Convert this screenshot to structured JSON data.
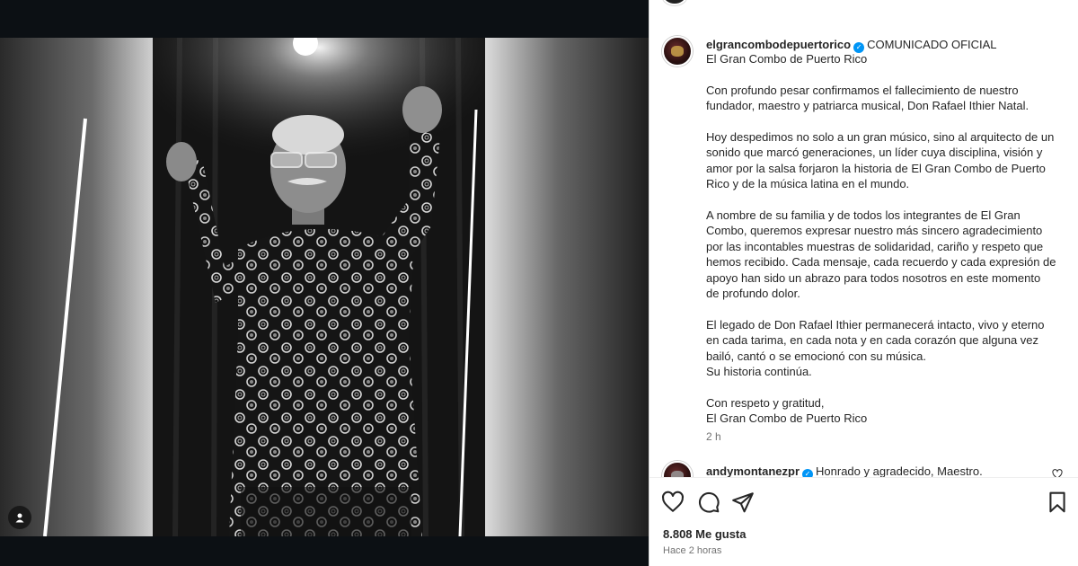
{
  "post": {
    "author": "elgrancombodepuertorico",
    "title": "COMUNICADO OFICIAL",
    "caption_lines": [
      "El Gran Combo de Puerto Rico",
      "",
      "Con profundo pesar confirmamos el fallecimiento de nuestro",
      "fundador, maestro y patriarca musical, Don Rafael Ithier Natal.",
      "",
      "Hoy despedimos no solo a un gran músico, sino al arquitecto de un",
      "sonido que marcó generaciones, un líder cuya disciplina, visión y",
      "amor por la salsa forjaron la historia de El Gran Combo de Puerto",
      "Rico y de la música latina en el mundo.",
      "",
      "A nombre de su familia y de todos los integrantes de El Gran",
      "Combo, queremos expresar nuestro más sincero agradecimiento",
      "por las incontables muestras de solidaridad, cariño y respeto que",
      "hemos recibido. Cada mensaje, cada recuerdo y cada expresión de",
      "apoyo han sido un abrazo para todos nosotros en este momento",
      "de profundo dolor.",
      "",
      "El legado de Don Rafael Ithier permanecerá intacto, vivo y eterno",
      "en cada tarima, en cada nota y en cada corazón que alguna vez",
      "bailó, cantó o se emocionó con su música.",
      "Su historia continúa.",
      "",
      "Con respeto y gratitud,",
      "El Gran Combo de Puerto Rico"
    ],
    "time": "2 h"
  },
  "comment": {
    "author": "andymontanezpr",
    "text": "Honrado y agradecido, Maestro."
  },
  "stats": {
    "likes": "8.808 Me gusta",
    "posted": "Hace 2 horas"
  },
  "icons": {
    "like": "heart-icon",
    "comment": "comment-icon",
    "share": "share-icon",
    "save": "bookmark-icon",
    "verified": "verified-badge-icon",
    "tag": "user-tag-icon"
  },
  "colors": {
    "verified": "#0095f6",
    "muted": "#737373",
    "text": "#262626"
  }
}
